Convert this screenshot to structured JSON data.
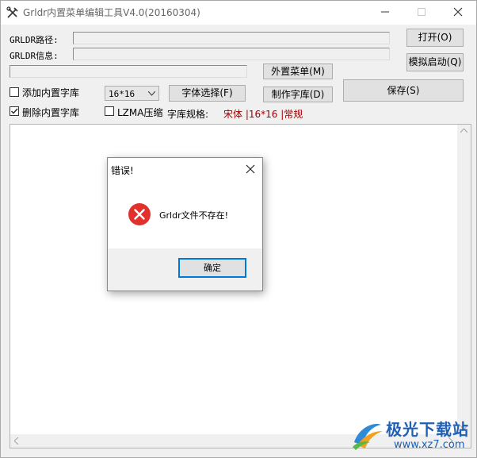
{
  "window": {
    "title": "Grldr内置菜单编辑工具V4.0(20160304)"
  },
  "form": {
    "path_label": "GRLDR路径:",
    "info_label": "GRLDR信息:",
    "path_value": "",
    "info_value": "",
    "extra_value": ""
  },
  "buttons": {
    "open": "打开(O)",
    "simulate": "模拟启动(Q)",
    "external_menu": "外置菜单(M)",
    "font_select": "字体选择(F)",
    "make_font": "制作字库(D)",
    "save": "保存(S)"
  },
  "options": {
    "add_builtin_font": "添加内置字库",
    "add_builtin_font_checked": false,
    "delete_builtin_font": "删除内置字库",
    "delete_builtin_font_checked": true,
    "lzma": "LZMA压缩",
    "lzma_checked": false,
    "size_selected": "16*16",
    "font_spec_label": "字库规格:",
    "font_spec_value": "宋体 |16*16 |常规",
    "font_spec_color": "#a00000"
  },
  "dialog": {
    "title": "错误!",
    "message": "Grldr文件不存在!",
    "ok": "确定",
    "icon": "error-icon",
    "icon_color": "#e2302c"
  },
  "watermark": {
    "title": "极光下载站",
    "url": "www.xz7.com"
  }
}
